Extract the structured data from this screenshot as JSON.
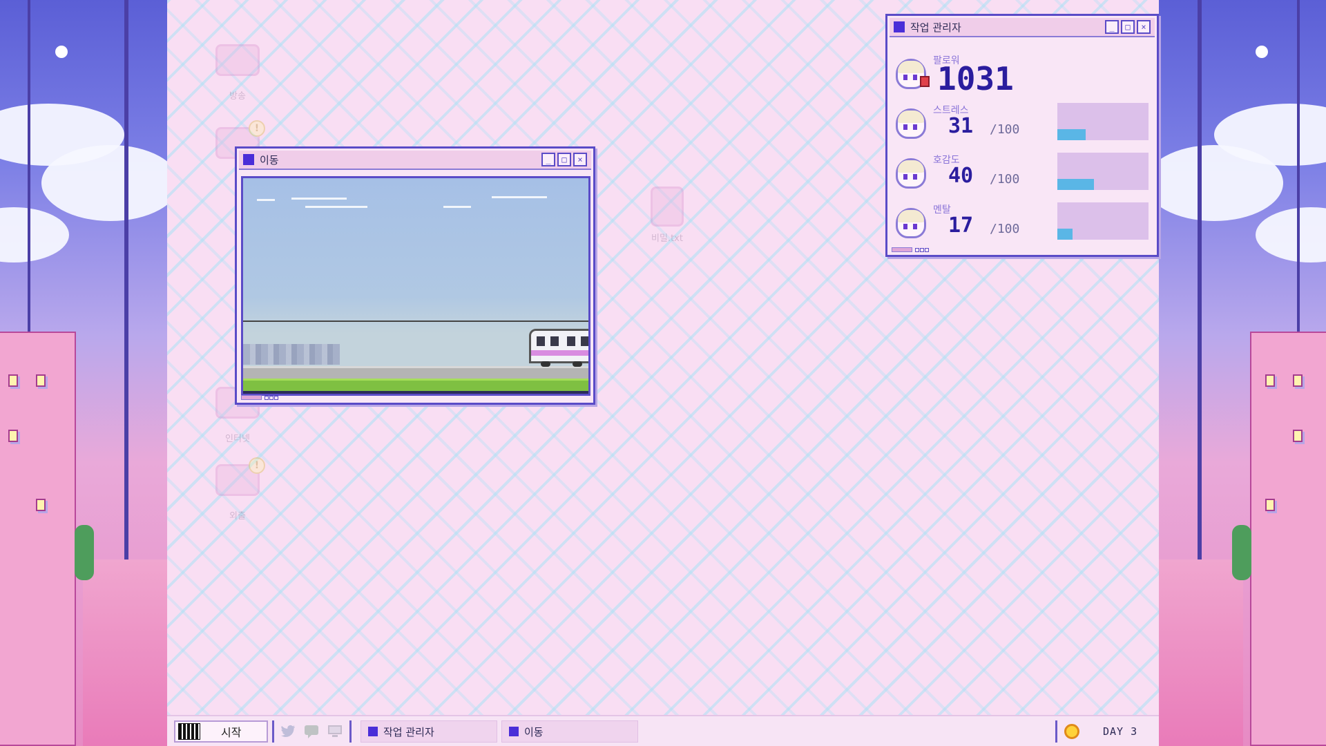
{
  "desktop": {
    "icons": [
      {
        "label": "방송",
        "icon": "broadcast-icon",
        "alert": ""
      },
      {
        "label": "",
        "icon": "app-icon",
        "alert": "!"
      },
      {
        "label": "비밀.txt",
        "icon": "text-file-icon",
        "alert": ""
      },
      {
        "label": "인터넷",
        "icon": "internet-icon",
        "alert": ""
      },
      {
        "label": "외출",
        "icon": "outing-icon",
        "alert": "!"
      }
    ]
  },
  "travel_window": {
    "title": "이동"
  },
  "task_manager": {
    "title": "작업 관리자",
    "followers": {
      "label": "팔로워",
      "value": "1031"
    },
    "stats": [
      {
        "label": "스트레스",
        "value": "31",
        "max": "/100",
        "level": 0.31
      },
      {
        "label": "호감도",
        "value": "40",
        "max": "/100",
        "level": 0.4
      },
      {
        "label": "멘탈",
        "value": "17",
        "max": "/100",
        "level": 0.17
      }
    ]
  },
  "taskbar": {
    "start_label": "시작",
    "quick_icons": [
      "twitter-icon",
      "chat-icon",
      "computer-icon"
    ],
    "tasks": [
      {
        "label": "작업 관리자"
      },
      {
        "label": "이동"
      }
    ],
    "day_label": "DAY 3"
  },
  "colors": {
    "window_border": "#5a4bc7",
    "accent": "#4a2ed8",
    "stat_fill": "#5ab6e6",
    "desktop_bg": "#f9def3"
  }
}
